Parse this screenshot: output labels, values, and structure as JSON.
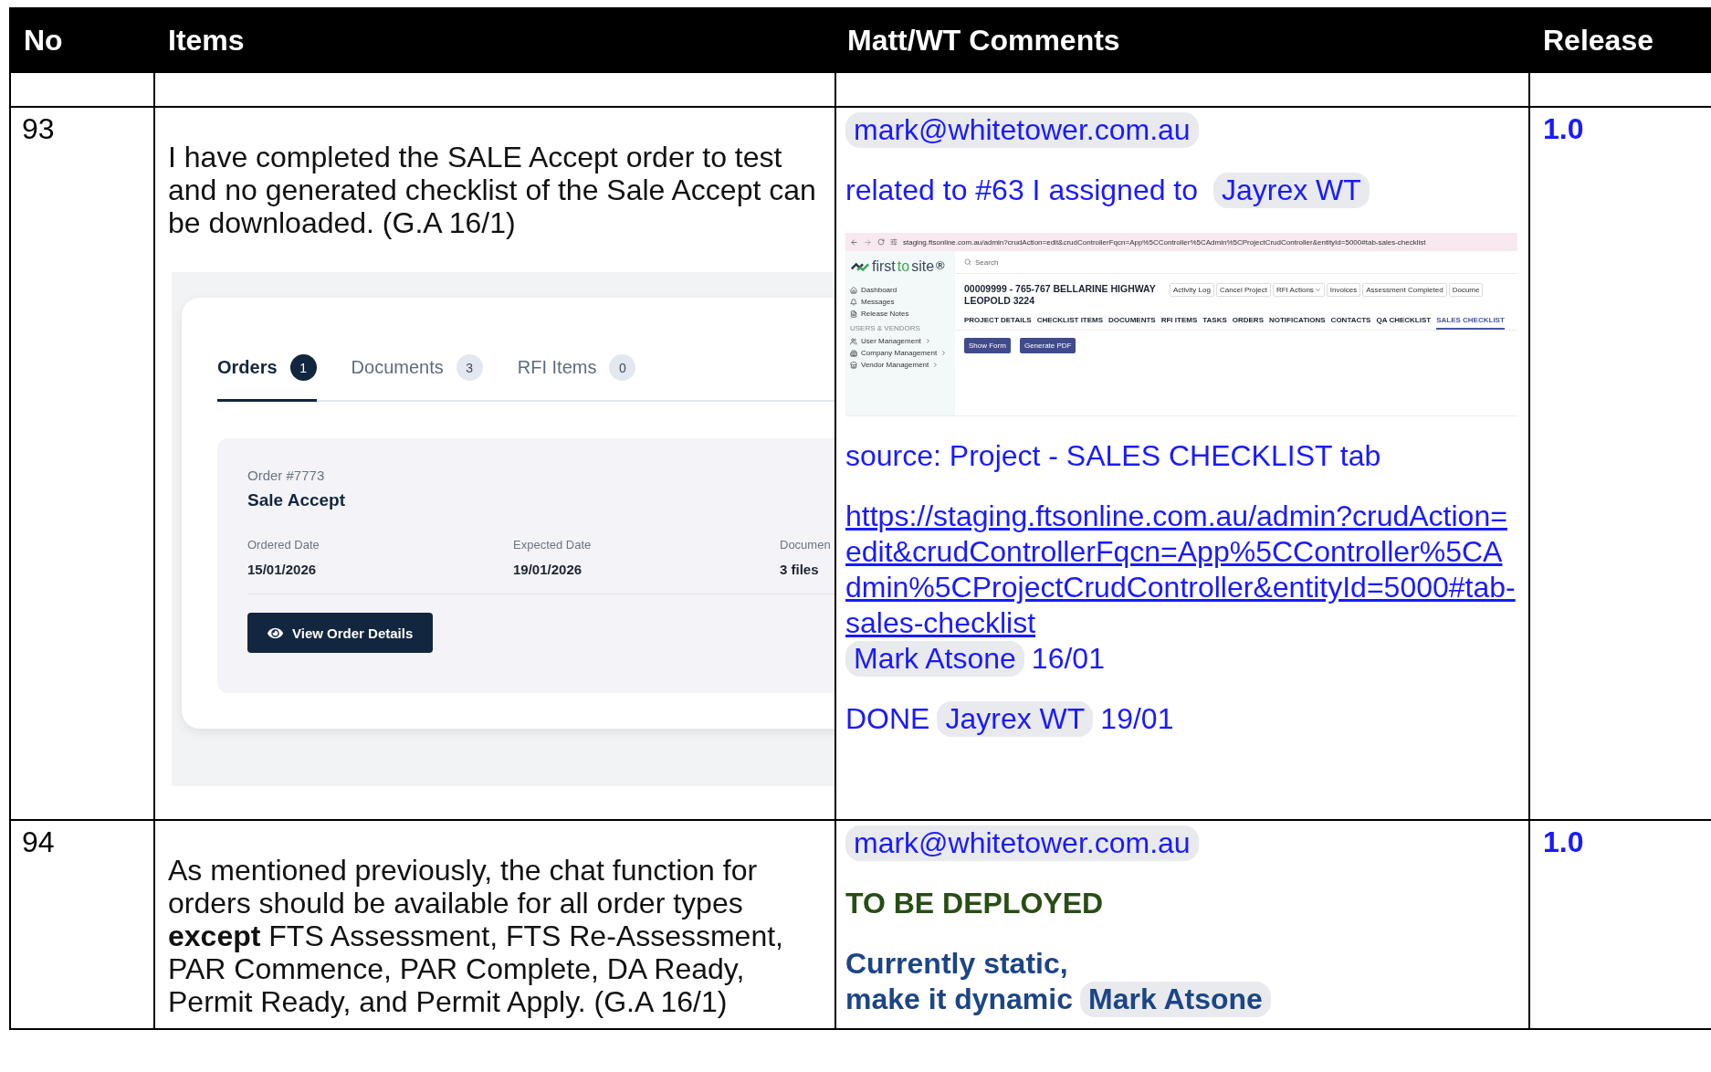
{
  "table": {
    "columns": [
      {
        "label": "No"
      },
      {
        "label": "Items"
      },
      {
        "label": "Matt/WT Comments"
      },
      {
        "label": "Release"
      }
    ],
    "rows": [
      {
        "no": "93",
        "item": {
          "text": "I have completed the SALE Accept order to test and no generated checklist of the Sale Accept can be downloaded. (G.A 16/1)",
          "screenshot": {
            "kind": "orders",
            "tabs": [
              {
                "label": "Orders",
                "count": "1",
                "selected": true
              },
              {
                "label": "Documents",
                "count": "3",
                "selected": false
              },
              {
                "label": "RFI Items",
                "count": "0",
                "selected": false
              }
            ],
            "order": {
              "number": "Order #7773",
              "title": "Sale Accept",
              "fields": [
                {
                  "label": "Ordered Date",
                  "value": "15/01/2026"
                },
                {
                  "label": "Expected Date",
                  "value": "19/01/2026"
                },
                {
                  "label": "Documen",
                  "value": "3 files"
                }
              ],
              "button": "View Order Details"
            }
          }
        },
        "comments": [
          {
            "kind": "text",
            "color": "#1a1aff",
            "bold": false,
            "lines": [
              [
                {
                  "kind": "mention",
                  "text": "mark@whitetower.com.au"
                }
              ]
            ]
          },
          {
            "kind": "text",
            "color": "#1a1aff",
            "bold": false,
            "lines": [
              [
                {
                  "kind": "text",
                  "text": "related to #63 I assigned to "
                },
                {
                  "kind": "mention",
                  "text": "Jayrex WT"
                }
              ]
            ]
          },
          {
            "kind": "screenshot",
            "app": {
              "url": "staging.ftsonline.com.au/admin?crudAction=edit&crudControllerFqcn=App%5CController%5CAdmin%5CProjectCrudController&entityId=5000#tab-sales-checklist",
              "logo_parts": [
                {
                  "text": "first",
                  "color": "#3b4a5c"
                },
                {
                  "text": "to",
                  "color": "#3aa655"
                },
                {
                  "text": "site",
                  "color": "#3b4a5c"
                },
                {
                  "text": "®",
                  "color": "#3b4a5c"
                }
              ],
              "search_placeholder": "Search",
              "sidebar_items": [
                {
                  "label": "Dashboard",
                  "expandable": false
                },
                {
                  "label": "Messages",
                  "expandable": false
                },
                {
                  "label": "Release Notes",
                  "expandable": false
                }
              ],
              "sidebar_section": "USERS & VENDORS",
              "section_items": [
                {
                  "label": "User Management",
                  "expandable": true
                },
                {
                  "label": "Company Management",
                  "expandable": true
                },
                {
                  "label": "Vendor Management",
                  "expandable": true
                }
              ],
              "title": "00009999 - 765-767 BELLARINE HIGHWAY LEOPOLD 3224",
              "actions": [
                {
                  "label": "Activity Log",
                  "dropdown": false
                },
                {
                  "label": "Cancel Project",
                  "dropdown": false
                },
                {
                  "label": "RFI Actions",
                  "dropdown": true
                },
                {
                  "label": "Invoices",
                  "dropdown": false
                },
                {
                  "label": "Assessment Completed",
                  "dropdown": false
                },
                {
                  "label": "Docume",
                  "dropdown": false
                }
              ],
              "tabs": [
                {
                  "label": "PROJECT DETAILS",
                  "selected": false
                },
                {
                  "label": "CHECKLIST ITEMS",
                  "selected": false
                },
                {
                  "label": "DOCUMENTS",
                  "selected": false
                },
                {
                  "label": "RFI ITEMS",
                  "selected": false
                },
                {
                  "label": "TASKS",
                  "selected": false
                },
                {
                  "label": "ORDERS",
                  "selected": false
                },
                {
                  "label": "NOTIFICATIONS",
                  "selected": false
                },
                {
                  "label": "CONTACTS",
                  "selected": false
                },
                {
                  "label": "QA CHECKLIST",
                  "selected": false
                },
                {
                  "label": "SALES CHECKLIST",
                  "selected": true
                }
              ],
              "buttons": [
                "Show Form",
                "Generate PDF"
              ]
            }
          },
          {
            "kind": "text",
            "color": "#1a1aff",
            "bold": false,
            "lines": [
              [
                {
                  "kind": "text",
                  "text": "source: Project - SALES CHECKLIST tab"
                }
              ]
            ]
          },
          {
            "kind": "text",
            "color": "#1a1aff",
            "bold": false,
            "lines": [
              [
                {
                  "kind": "link",
                  "text": "https://staging.ftsonline.com.au/admin?crudAction=edit&crudControllerFqcn=App%5CController%5CAdmin%5CProjectCrudController&entityId=5000#tab-sales-checklist"
                },
                {
                  "kind": "mention",
                  "text": "Mark Atsone"
                },
                {
                  "kind": "text",
                  "text": "16/01"
                }
              ]
            ]
          },
          {
            "kind": "text",
            "color": "#1a1aff",
            "bold": false,
            "lines": [
              [
                {
                  "kind": "text",
                  "text": "DONE"
                },
                {
                  "kind": "mention",
                  "text": "Jayrex WT"
                },
                {
                  "kind": "text",
                  "text": "19/01"
                }
              ]
            ]
          }
        ],
        "release": "1.0"
      },
      {
        "no": "94",
        "item": {
          "text": "As mentioned previously, the chat function for orders should be available for all order types **except** FTS Assessment, FTS Re-Assessment, PAR Commence, PAR Complete, DA Ready, Permit Ready, and Permit Apply. (G.A 16/1)"
        },
        "comments": [
          {
            "kind": "text",
            "color": "#1a1aff",
            "bold": false,
            "lines": [
              [
                {
                  "kind": "mention",
                  "text": "mark@whitetower.com.au"
                }
              ]
            ]
          },
          {
            "kind": "text",
            "color": "#274e13",
            "bold": true,
            "lines": [
              [
                {
                  "kind": "text",
                  "text": "TO BE DEPLOYED"
                }
              ]
            ]
          },
          {
            "kind": "text",
            "color": "#1c4587",
            "bold": true,
            "lines": [
              [
                {
                  "kind": "text",
                  "text": "Currently static,"
                }
              ],
              [
                {
                  "kind": "text",
                  "text": "make it dynamic"
                },
                {
                  "kind": "mention",
                  "text": "Mark Atsone"
                }
              ]
            ]
          }
        ],
        "release": "1.0"
      }
    ]
  }
}
